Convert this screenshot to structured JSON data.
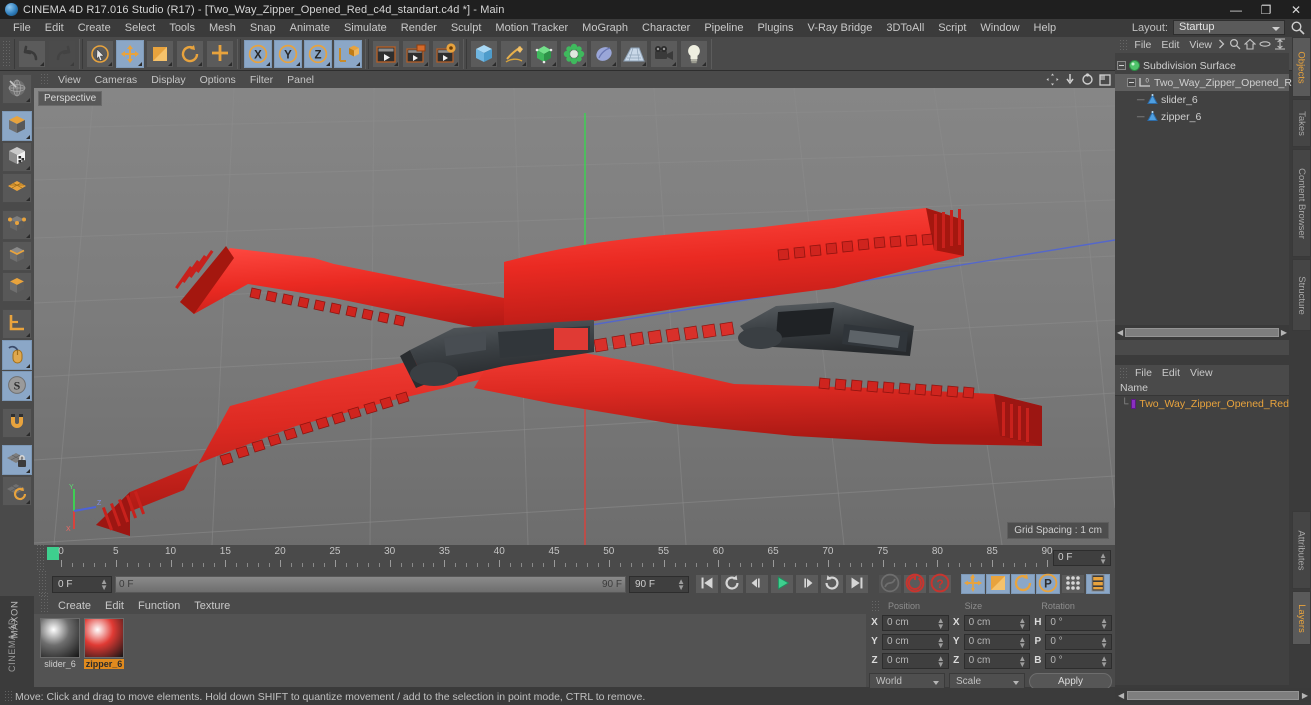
{
  "window": {
    "title": "CINEMA 4D R17.016 Studio (R17) - [Two_Way_Zipper_Opened_Red_c4d_standart.c4d *] - Main",
    "minimize": "—",
    "maximize": "❐",
    "close": "✕"
  },
  "menubar": {
    "items": [
      "File",
      "Edit",
      "Create",
      "Select",
      "Tools",
      "Mesh",
      "Snap",
      "Animate",
      "Simulate",
      "Render",
      "Sculpt",
      "Motion Tracker",
      "MoGraph",
      "Character",
      "Pipeline",
      "Plugins",
      "V-Ray Bridge",
      "3DToAll",
      "Script",
      "Window",
      "Help"
    ],
    "layout_label": "Layout:",
    "layout_value": "Startup",
    "search_icon": "search-icon"
  },
  "toolbar": {
    "groups": [
      {
        "name": "history",
        "buttons": [
          {
            "name": "undo-button",
            "icon": "undo-arrow-icon",
            "state": "normal"
          },
          {
            "name": "redo-button",
            "icon": "redo-arrow-icon",
            "state": "disabled"
          }
        ]
      },
      {
        "name": "selection",
        "buttons": [
          {
            "name": "live-selection-button",
            "icon": "live-selection-icon",
            "state": "normal"
          },
          {
            "name": "move-tool-button",
            "icon": "move-axis-icon",
            "state": "selected"
          },
          {
            "name": "scale-tool-button",
            "icon": "scale-icon",
            "state": "normal"
          },
          {
            "name": "rotate-tool-button",
            "icon": "rotate-icon",
            "state": "normal"
          },
          {
            "name": "move-duplicate-button",
            "icon": "plus-axis-icon",
            "state": "normal"
          }
        ]
      },
      {
        "name": "axis-locks",
        "buttons": [
          {
            "name": "lock-x-button",
            "icon": "axis-x-icon",
            "state": "selected"
          },
          {
            "name": "lock-y-button",
            "icon": "axis-y-icon",
            "state": "selected"
          },
          {
            "name": "lock-z-button",
            "icon": "axis-z-icon",
            "state": "selected"
          },
          {
            "name": "world-object-coordinate-button",
            "icon": "world-cube-icon",
            "state": "selected"
          }
        ]
      },
      {
        "name": "render",
        "buttons": [
          {
            "name": "render-view-button",
            "icon": "render-view-icon",
            "state": "normal"
          },
          {
            "name": "render-to-picture-viewer-button",
            "icon": "render-picture-icon",
            "state": "normal"
          },
          {
            "name": "render-settings-button",
            "icon": "render-settings-icon",
            "state": "normal"
          }
        ]
      },
      {
        "name": "create",
        "buttons": [
          {
            "name": "add-cube-object-button",
            "icon": "cube-icon",
            "state": "normal"
          },
          {
            "name": "add-spline-button",
            "icon": "pen-spline-icon",
            "state": "normal"
          },
          {
            "name": "add-generator-button",
            "icon": "generator-icon",
            "state": "normal"
          },
          {
            "name": "add-deformer-button",
            "icon": "deformer-icon",
            "state": "normal"
          },
          {
            "name": "add-scene-object-button",
            "icon": "environment-icon",
            "state": "normal"
          },
          {
            "name": "add-floor-button",
            "icon": "floor-grid-icon",
            "state": "normal"
          },
          {
            "name": "add-camera-button",
            "icon": "camera-icon",
            "state": "normal"
          },
          {
            "name": "add-light-button",
            "icon": "light-bulb-icon",
            "state": "normal"
          }
        ]
      }
    ]
  },
  "left_toolbar": {
    "buttons": [
      {
        "name": "make-editable-button",
        "icon": "make-editable-icon",
        "state": "normal"
      },
      {
        "name": "model-mode-button",
        "icon": "model-cube-icon",
        "state": "selected"
      },
      {
        "name": "texture-mode-button",
        "icon": "texture-cube-icon",
        "state": "normal"
      },
      {
        "name": "workplane-mode-button",
        "icon": "workplane-icon",
        "state": "normal"
      },
      {
        "name": "points-mode-button",
        "icon": "points-icon",
        "state": "normal"
      },
      {
        "name": "edges-mode-button",
        "icon": "edges-icon",
        "state": "normal"
      },
      {
        "name": "polygons-mode-button",
        "icon": "polygons-icon",
        "state": "normal"
      },
      {
        "name": "object-axis-mode-button",
        "icon": "axis-corner-icon",
        "state": "normal"
      },
      {
        "name": "enable-axis-modification-button",
        "icon": "mouse-axis-icon",
        "state": "selected"
      },
      {
        "name": "soft-selection-button",
        "icon": "soft-selection-s-icon",
        "state": "selected"
      },
      {
        "name": "snap-button",
        "icon": "magnet-icon",
        "state": "normal"
      },
      {
        "name": "lock-workplane-button",
        "icon": "workplane-lock-icon",
        "state": "selected"
      },
      {
        "name": "workplane-rotate-button",
        "icon": "workplane-rotate-icon",
        "state": "normal"
      }
    ]
  },
  "viewport": {
    "menu": [
      "View",
      "Cameras",
      "Display",
      "Options",
      "Filter",
      "Panel"
    ],
    "label": "Perspective",
    "grid_spacing": "Grid Spacing : 1 cm",
    "nav_icons": [
      "pan-icon",
      "dolly-icon",
      "rotate-view-icon",
      "maximize-view-icon"
    ],
    "axis_gizmo": {
      "y": "Y",
      "x": "X",
      "z": "Z"
    }
  },
  "timeline": {
    "ticks": [
      0,
      5,
      10,
      15,
      20,
      25,
      30,
      35,
      40,
      45,
      50,
      55,
      60,
      65,
      70,
      75,
      80,
      85,
      90
    ],
    "start": 0,
    "end": 90,
    "current_frame_field": "0 F",
    "playhead_frame": 0
  },
  "playback": {
    "current_frame": "0 F",
    "range_start": "0 F",
    "range_end": "90 F",
    "end_frame_field": "90 F",
    "buttons": [
      {
        "name": "go-to-start-button",
        "icon": "skip-start-icon"
      },
      {
        "name": "play-backwards-loop-button",
        "icon": "loop-ccw-icon"
      },
      {
        "name": "step-back-button",
        "icon": "step-back-icon"
      },
      {
        "name": "play-button",
        "icon": "play-icon"
      },
      {
        "name": "step-forward-button",
        "icon": "step-forward-icon"
      },
      {
        "name": "loop-forward-button",
        "icon": "loop-cw-icon"
      },
      {
        "name": "go-to-end-button",
        "icon": "skip-end-icon"
      }
    ],
    "record_buttons": [
      {
        "name": "autokeying-button",
        "icon": "autokey-icon",
        "state": "disabled"
      },
      {
        "name": "record-active-objects-button",
        "icon": "record-circle-icon",
        "state": "normal"
      },
      {
        "name": "keyframe-selection-button",
        "icon": "keyframe-question-icon",
        "state": "normal"
      }
    ],
    "key_toggles": [
      {
        "name": "position-key-button",
        "icon": "position-key-icon",
        "state": "selected"
      },
      {
        "name": "scale-key-button",
        "icon": "scale-key-icon",
        "state": "selected"
      },
      {
        "name": "rotation-key-button",
        "icon": "rotation-key-icon",
        "state": "selected"
      },
      {
        "name": "parameter-key-button",
        "icon": "parameter-p-icon",
        "state": "selected"
      },
      {
        "name": "point-level-animation-button",
        "icon": "pla-dots-icon",
        "state": "normal"
      },
      {
        "name": "timeline-layout-button",
        "icon": "timeline-layout-icon",
        "state": "selected"
      }
    ]
  },
  "material_manager": {
    "menu": [
      "Create",
      "Edit",
      "Function",
      "Texture"
    ],
    "materials": [
      {
        "name": "slider_6",
        "color": "#6e6e6e",
        "selected": false
      },
      {
        "name": "zipper_6",
        "color": "#e03a34",
        "selected": true
      }
    ]
  },
  "coordinates": {
    "headers": [
      "Position",
      "Size",
      "Rotation"
    ],
    "rows": [
      {
        "pos_label": "X",
        "pos_value": "0 cm",
        "size_label": "X",
        "size_value": "0 cm",
        "rot_label": "H",
        "rot_value": "0 °"
      },
      {
        "pos_label": "Y",
        "pos_value": "0 cm",
        "size_label": "Y",
        "size_value": "0 cm",
        "rot_label": "P",
        "rot_value": "0 °"
      },
      {
        "pos_label": "Z",
        "pos_value": "0 cm",
        "size_label": "Z",
        "size_value": "0 cm",
        "rot_label": "B",
        "rot_value": "0 °"
      }
    ],
    "system": "World",
    "mode": "Scale",
    "apply": "Apply"
  },
  "object_manager": {
    "menu": [
      "File",
      "Edit",
      "View"
    ],
    "more_icon": "chevron-right-icon",
    "tool_icons": [
      "search-icon",
      "home-icon",
      "minus-icon",
      "fit-icon"
    ],
    "tree": [
      {
        "name": "Subdivision Surface",
        "depth": 0,
        "icon": "subdivision-surface-icon",
        "selected": false
      },
      {
        "name": "Two_Way_Zipper_Opened_Red",
        "depth": 1,
        "icon": "null-object-icon",
        "selected": true
      },
      {
        "name": "slider_6",
        "depth": 2,
        "icon": "polygon-object-icon",
        "selected": false
      },
      {
        "name": "zipper_6",
        "depth": 2,
        "icon": "polygon-object-icon",
        "selected": false
      }
    ]
  },
  "attributes_manager": {
    "menu": [
      "File",
      "Edit",
      "View"
    ],
    "column_header": "Name",
    "rows": [
      {
        "name": "Two_Way_Zipper_Opened_Red",
        "swatch": "#8a2fc0"
      }
    ]
  },
  "right_tabs": {
    "top": [
      {
        "label": "Objects",
        "active": true
      },
      {
        "label": "Takes",
        "active": false
      },
      {
        "label": "Content Browser",
        "active": false
      },
      {
        "label": "Structure",
        "active": false
      }
    ],
    "bottom": [
      {
        "label": "Attributes",
        "active": false
      },
      {
        "label": "Layers",
        "active": true
      }
    ]
  },
  "statusbar": {
    "text": "Move: Click and drag to move elements. Hold down SHIFT to quantize movement / add to the selection in point mode, CTRL to remove."
  },
  "colors": {
    "accent": "#e8a33d",
    "selection_blue": "#8ba7c7",
    "zipper_red": "#e8322a",
    "slider_dark": "#434343",
    "play_green": "#3ecf8e"
  }
}
